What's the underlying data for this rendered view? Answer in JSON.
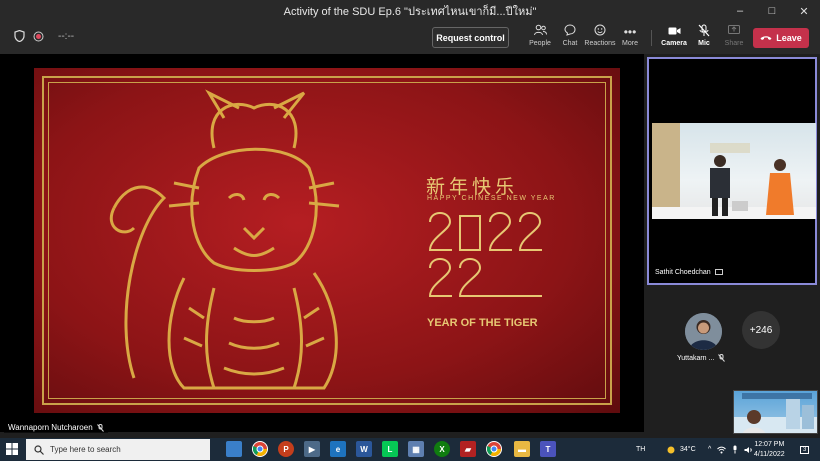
{
  "window": {
    "title": "Activity of the SDU Ep.6 \"ประเทศไหนเขาก็มี...ปีใหม่\"",
    "controls": [
      "–",
      "□",
      "✕"
    ]
  },
  "toolbar": {
    "timer": "--:--",
    "request_control": "Request control",
    "buttons": [
      {
        "label": "People",
        "icon": "people-icon"
      },
      {
        "label": "Chat",
        "icon": "chat-icon"
      },
      {
        "label": "Reactions",
        "icon": "reactions-icon"
      },
      {
        "label": "More",
        "icon": "more-icon"
      },
      {
        "label": "Camera",
        "icon": "camera-icon"
      },
      {
        "label": "Mic",
        "icon": "mic-icon"
      },
      {
        "label": "Share",
        "icon": "share-icon"
      }
    ],
    "leave": "Leave"
  },
  "stage": {
    "presenter": "Wannaporn Nutcharoen",
    "slide": {
      "chinese": "新年快乐",
      "greeting": "HAPPY CHINESE NEW YEAR",
      "year": "2022",
      "subtitle": "YEAR OF THE TIGER"
    }
  },
  "participants": {
    "featured": "Sathit Choedchan",
    "second": "Yuttakarn ...",
    "overflow": "+246"
  },
  "taskbar": {
    "search_placeholder": "Type here to search",
    "language": "TH",
    "temperature": "34°C",
    "time": "12:07 PM",
    "date": "4/11/2022",
    "notifications": "3"
  },
  "colors": {
    "leave": "#c4314b",
    "gold": "#e7c873",
    "slide_red": "#b51e22",
    "active_border": "#8a8ad8"
  }
}
